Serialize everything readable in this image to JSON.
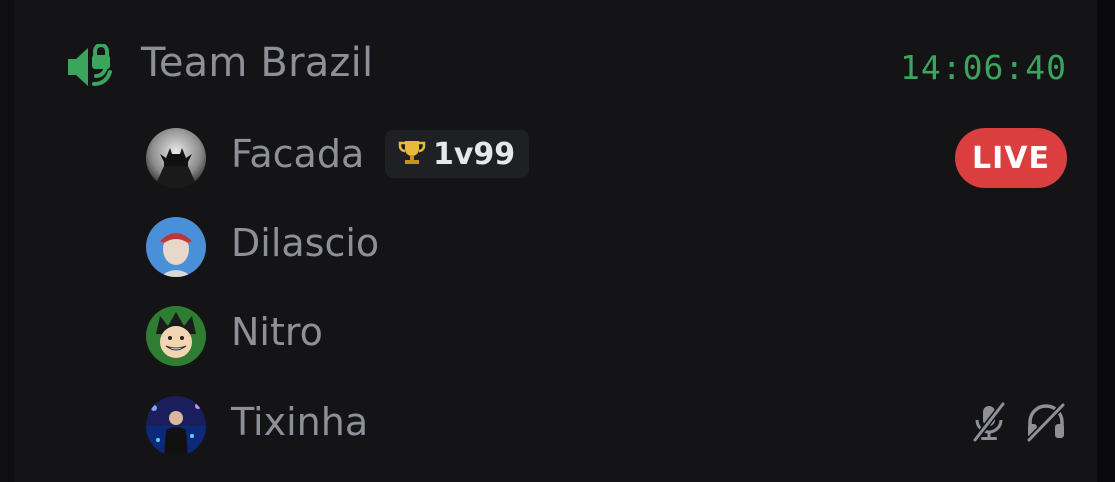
{
  "channel": {
    "name": "Team Brazil",
    "elapsed": "14:06:40",
    "icon": "voice-channel-locked-icon",
    "icon_color": "#3ba55d"
  },
  "members": [
    {
      "name": "Facada",
      "avatar": "batman-avatar",
      "badge": {
        "icon": "trophy-icon",
        "text": "1v99"
      },
      "live_label": "LIVE"
    },
    {
      "name": "Dilascio",
      "avatar": "cartoon-cap-avatar"
    },
    {
      "name": "Nitro",
      "avatar": "anime-boy-avatar"
    },
    {
      "name": "Tixinha",
      "avatar": "stage-person-avatar",
      "muted": true,
      "deafened": true
    }
  ],
  "colors": {
    "background": "#141417",
    "text_muted": "#8e9098",
    "live": "#da3e3e",
    "timer": "#3ba55d"
  }
}
